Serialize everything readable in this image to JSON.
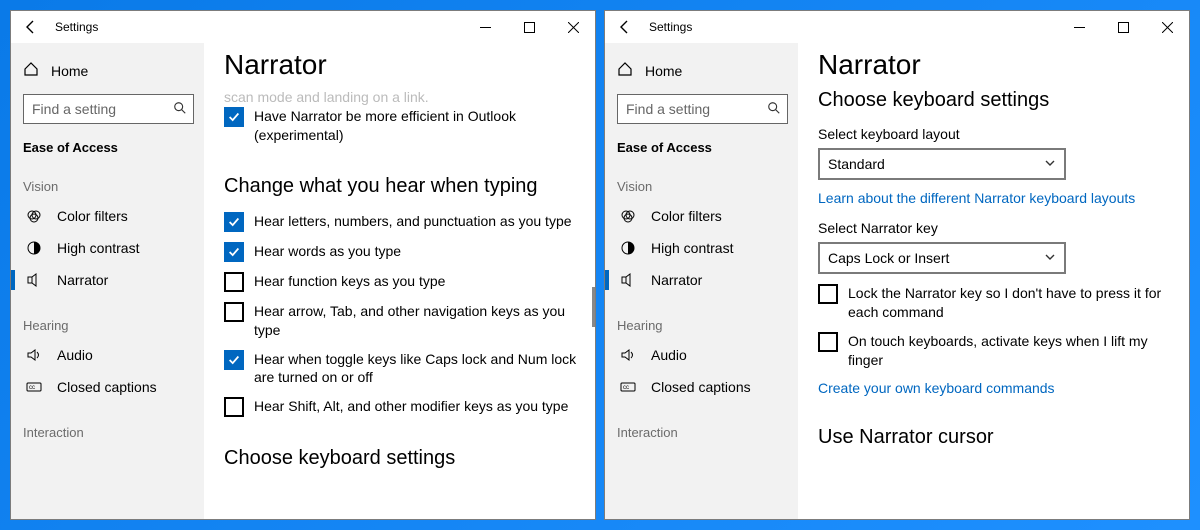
{
  "titlebar": {
    "title": "Settings"
  },
  "sidebar": {
    "home": "Home",
    "search_placeholder": "Find a setting",
    "category": "Ease of Access",
    "groups": {
      "vision": "Vision",
      "hearing": "Hearing",
      "interaction": "Interaction"
    },
    "items": {
      "color_filters": "Color filters",
      "high_contrast": "High contrast",
      "narrator": "Narrator",
      "audio": "Audio",
      "closed_captions": "Closed captions"
    }
  },
  "left": {
    "page_title": "Narrator",
    "clipped_text": "scan mode and landing on a link.",
    "outlook_checkbox": "Have Narrator be more efficient in Outlook (experimental)",
    "section_typing": "Change what you hear when typing",
    "typing": {
      "letters": "Hear letters, numbers, and punctuation as you type",
      "words": "Hear words as you type",
      "function": "Hear function keys as you type",
      "arrow": "Hear arrow, Tab, and other navigation keys as you type",
      "toggle": "Hear when toggle keys like Caps lock and Num lock are turned on or off",
      "modifier": "Hear Shift, Alt, and other modifier keys as you type"
    },
    "section_keyboard": "Choose keyboard settings"
  },
  "right": {
    "page_title": "Narrator",
    "section_keyboard": "Choose keyboard settings",
    "layout_label": "Select keyboard layout",
    "layout_value": "Standard",
    "layout_link": "Learn about the different Narrator keyboard layouts",
    "narrator_key_label": "Select Narrator key",
    "narrator_key_value": "Caps Lock or Insert",
    "lock_checkbox": "Lock the Narrator key so I don't have to press it for each command",
    "touch_checkbox": "On touch keyboards, activate keys when I lift my finger",
    "commands_link": "Create your own keyboard commands",
    "section_cursor": "Use Narrator cursor"
  }
}
